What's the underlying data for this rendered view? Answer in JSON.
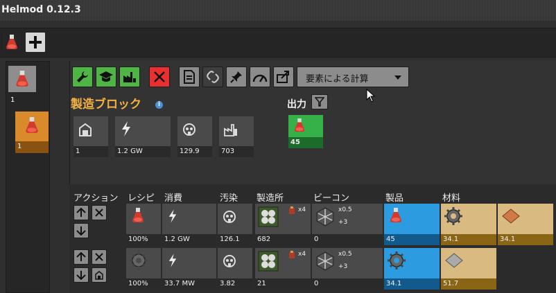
{
  "window": {
    "title": "Helmod 0.12.3"
  },
  "left_panel": {
    "items": [
      {
        "count": "1",
        "icon": "flask-icon"
      },
      {
        "count": "1",
        "icon": "flask-locked-icon"
      }
    ]
  },
  "dropdown": {
    "selected": "要素による計算"
  },
  "block": {
    "title": "製造ブロック",
    "stats": [
      {
        "icon": "factory-icon",
        "value": "1"
      },
      {
        "icon": "lightning-icon",
        "value": "1.2 GW"
      },
      {
        "icon": "pollution-icon",
        "value": "129.9"
      },
      {
        "icon": "building-icon",
        "value": "703"
      }
    ],
    "output_label": "出力",
    "output": {
      "icon": "flask-icon",
      "value": "45"
    }
  },
  "table": {
    "headers": [
      "アクション",
      "レシピ",
      "消費",
      "汚染",
      "製造所",
      "ビーコン",
      "製品",
      "材料"
    ],
    "rows": [
      {
        "recipe_pct": "100%",
        "energy": "1.2 GW",
        "pollution": "126.1",
        "factory_count": "682",
        "factory_modules": "x4",
        "beacon_mult": "x0.5",
        "beacon_plus": "+3",
        "beacon_count": "0",
        "product": "45",
        "ingredients": [
          "34.1",
          "34.1"
        ]
      },
      {
        "recipe_pct": "100%",
        "energy": "33.7 MW",
        "pollution": "3.82",
        "factory_count": "21",
        "factory_modules": "x4",
        "beacon_mult": "x0.5",
        "beacon_plus": "+3",
        "beacon_count": "0",
        "product": "34.1",
        "ingredients": [
          "51.7"
        ]
      }
    ]
  },
  "colors": {
    "green": "#4fb545",
    "orange": "#f5b243",
    "blue": "#2d9be0",
    "tan": "#d9bb82",
    "red": "#e83030"
  }
}
